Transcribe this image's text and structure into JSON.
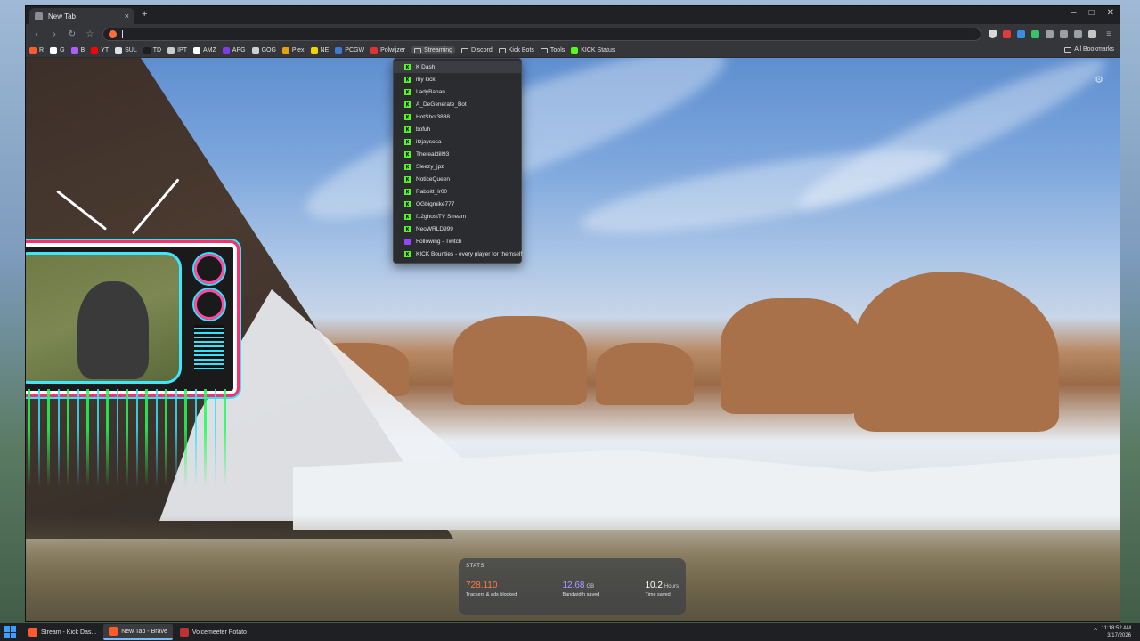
{
  "window": {
    "tab_title": "New Tab",
    "tab_close": "×",
    "new_tab": "+",
    "controls": {
      "minimize": "–",
      "maximize": "□",
      "close": "✕"
    }
  },
  "toolbar": {
    "back": "‹",
    "forward": "›",
    "reload": "↻",
    "bookmark": "☆",
    "menu": "≡"
  },
  "bookmarks": [
    {
      "label": "R",
      "icon": "brave-icon",
      "color": "#ff5a2b",
      "folder": false
    },
    {
      "label": "G",
      "icon": "google-icon",
      "color": "#ffffff",
      "folder": false
    },
    {
      "label": "B",
      "icon": "bing-icon",
      "color": "#b05cff",
      "folder": false
    },
    {
      "label": "YT",
      "icon": "youtube-icon",
      "color": "#ff0000",
      "folder": false
    },
    {
      "label": "SUL",
      "icon": "sul-icon",
      "color": "#e0e0e0",
      "folder": false
    },
    {
      "label": "TD",
      "icon": "td-icon",
      "color": "#1e1e1e",
      "folder": false
    },
    {
      "label": "IPT",
      "icon": "ipt-icon",
      "color": "#cccccc",
      "folder": false
    },
    {
      "label": "AMZ",
      "icon": "amazon-icon",
      "color": "#ffffff",
      "folder": false
    },
    {
      "label": "APG",
      "icon": "apg-icon",
      "color": "#7b3fe4",
      "folder": false
    },
    {
      "label": "GOG",
      "icon": "gog-icon",
      "color": "#cfcfcf",
      "folder": false
    },
    {
      "label": "Plex",
      "icon": "plex-icon",
      "color": "#e5a00d",
      "folder": false
    },
    {
      "label": "NE",
      "icon": "ne-icon",
      "color": "#f3d400",
      "folder": false
    },
    {
      "label": "PCGW",
      "icon": "pcgw-icon",
      "color": "#3a7bd5",
      "folder": false
    },
    {
      "label": "Polwijzer",
      "icon": "polwijzer-icon",
      "color": "#d33",
      "folder": false
    },
    {
      "label": "Streaming",
      "icon": "folder-icon",
      "color": "#c9c9c9",
      "folder": true,
      "active": true
    },
    {
      "label": "Discord",
      "icon": "folder-icon",
      "color": "#c9c9c9",
      "folder": true
    },
    {
      "label": "Kick Bots",
      "icon": "folder-icon",
      "color": "#c9c9c9",
      "folder": true
    },
    {
      "label": "Tools",
      "icon": "folder-icon",
      "color": "#c9c9c9",
      "folder": true
    },
    {
      "label": "KICK Status",
      "icon": "kick-icon",
      "color": "#53fc18",
      "folder": false
    }
  ],
  "all_bookmarks": "All Bookmarks",
  "streaming_menu": [
    {
      "label": "K Dash",
      "icon": "kick",
      "hover": true
    },
    {
      "label": "my kick",
      "icon": "kick"
    },
    {
      "label": "LadyBanan",
      "icon": "kick"
    },
    {
      "label": "A_DeGenerate_Bot",
      "icon": "kick"
    },
    {
      "label": "HotShot3888",
      "icon": "kick"
    },
    {
      "label": "bofuh",
      "icon": "kick"
    },
    {
      "label": "itzjaysosa",
      "icon": "kick"
    },
    {
      "label": "Therealdill93",
      "icon": "kick"
    },
    {
      "label": "Sleezy_jpz",
      "icon": "kick"
    },
    {
      "label": "NoticeQueen",
      "icon": "kick"
    },
    {
      "label": "Rabbitt_lr00",
      "icon": "kick"
    },
    {
      "label": "OGbigmike777",
      "icon": "kick"
    },
    {
      "label": "f12ghostTV Stream",
      "icon": "kick"
    },
    {
      "label": "NeoWRLD999",
      "icon": "kick"
    },
    {
      "label": "Following - Twitch",
      "icon": "twitch"
    },
    {
      "label": "KICK Bounties - every player for themself",
      "icon": "kick"
    }
  ],
  "stats": {
    "header": "STATS",
    "trackers": {
      "value": "728,110",
      "unit": "",
      "label": "Trackers & ads blocked",
      "color": "#ff7a45"
    },
    "bandwidth": {
      "value": "12.68",
      "unit": "GB",
      "label": "Bandwidth saved",
      "color": "#a99cff"
    },
    "time": {
      "value": "10.2",
      "unit": "Hours",
      "label": "Time saved",
      "color": "#ffffff"
    }
  },
  "taskbar": {
    "items": [
      {
        "label": "Stream - Kick Das...",
        "color": "#ff5a2b",
        "active": false
      },
      {
        "label": "New Tab - Brave",
        "color": "#ff5a2b",
        "active": true
      },
      {
        "label": "Voicemeeter Potato",
        "color": "#b33",
        "active": false
      }
    ],
    "time": "11:18:52 AM",
    "date": "3/17/2026"
  }
}
